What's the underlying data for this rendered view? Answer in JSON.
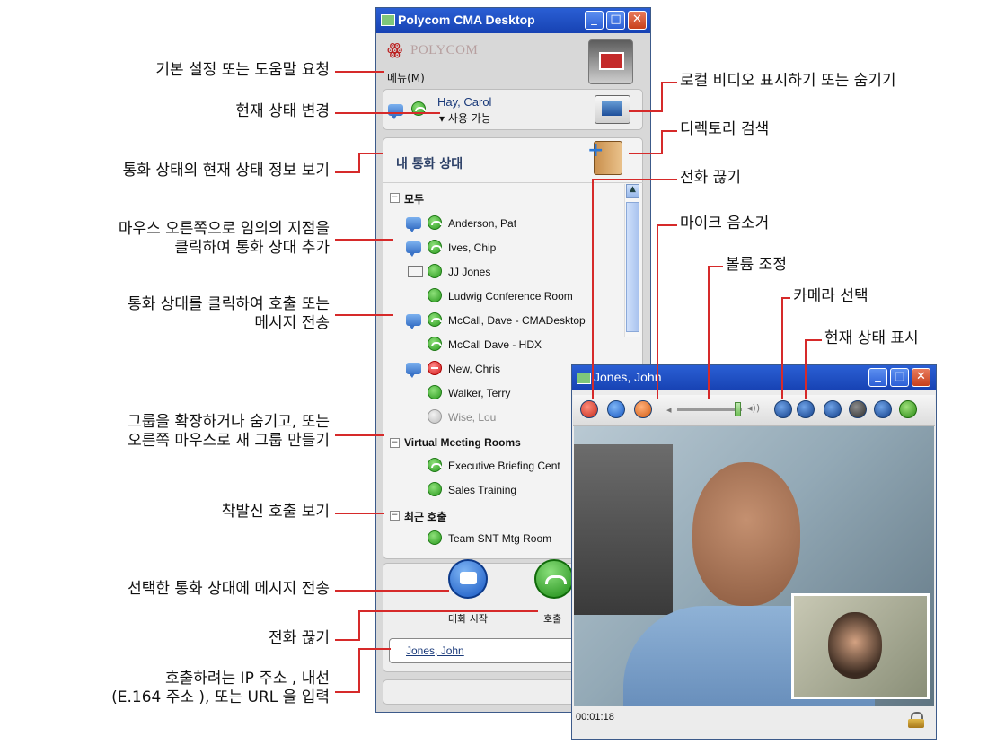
{
  "main_window": {
    "title": "Polycom CMA Desktop",
    "brand": "POLYCOM",
    "menu_label": "메뉴(M)",
    "user_name": "Hay, Carol",
    "user_status": "▾ 사용 가능",
    "contacts_header": "내 통화 상대",
    "groups": [
      {
        "toggle": "−",
        "name": "모두"
      },
      {
        "toggle": "−",
        "name": "Virtual Meeting Rooms"
      },
      {
        "toggle": "−",
        "name": "최근 호출"
      }
    ],
    "contacts": [
      {
        "name": "Anderson, Pat",
        "status": "available"
      },
      {
        "name": "Ives, Chip",
        "status": "available"
      },
      {
        "name": "JJ Jones",
        "status": "available"
      },
      {
        "name": "Ludwig Conference Room",
        "status": "available"
      },
      {
        "name": "McCall, Dave - CMADesktop",
        "status": "available"
      },
      {
        "name": "McCall Dave - HDX",
        "status": "available"
      },
      {
        "name": "New, Chris",
        "status": "busy"
      },
      {
        "name": "Walker, Terry",
        "status": "available"
      },
      {
        "name": "Wise, Lou",
        "status": "offline"
      },
      {
        "name": "Executive Briefing Cent",
        "status": "available"
      },
      {
        "name": "Sales Training",
        "status": "available"
      },
      {
        "name": "Team SNT Mtg Room",
        "status": "available"
      }
    ],
    "chat_label": "대화 시작",
    "call_label": "호출",
    "dial_value": "Jones, John"
  },
  "video_window": {
    "title": "Jones, John",
    "timer": "00:01:18"
  },
  "callouts": {
    "menu": "기본 설정 또는 도움말 요청",
    "status_change": "현재 상태 변경",
    "contact_status": "통화 상태의 현재 상태 정보 보기",
    "add_contact_1": "마우스 오른쪽으로 임의의 지점을",
    "add_contact_2": "클릭하여 통화 상대 추가",
    "call_msg_1": "통화 상대를 클릭하여 호출 또는",
    "call_msg_2": "메시지 전송",
    "groups_1": "그룹을 확장하거나 숨기고, 또는",
    "groups_2": "오른쪽 마우스로 새 그룹 만들기",
    "recent": "착발신 호출 보기",
    "send_msg": "선택한 통화 상대에 메시지 전송",
    "hangup_left": "전화 끊기",
    "dial_1": "호출하려는 IP 주소 , 내선",
    "dial_2": "(E.164 주소 ), 또는 URL 을 입력",
    "local_video": "로컬 비디오 표시하기 또는 숨기기",
    "directory": "디렉토리 검색",
    "hangup_right": "전화 끊기",
    "mute": "마이크 음소거",
    "volume": "볼륨 조정",
    "camera": "카메라 선택",
    "presence": "현재 상태 표시"
  },
  "colors": {
    "accent": "#d62a2a",
    "titlebar": "#2a5fd4",
    "available": "#2a9a1e",
    "busy": "#d21b1b"
  }
}
